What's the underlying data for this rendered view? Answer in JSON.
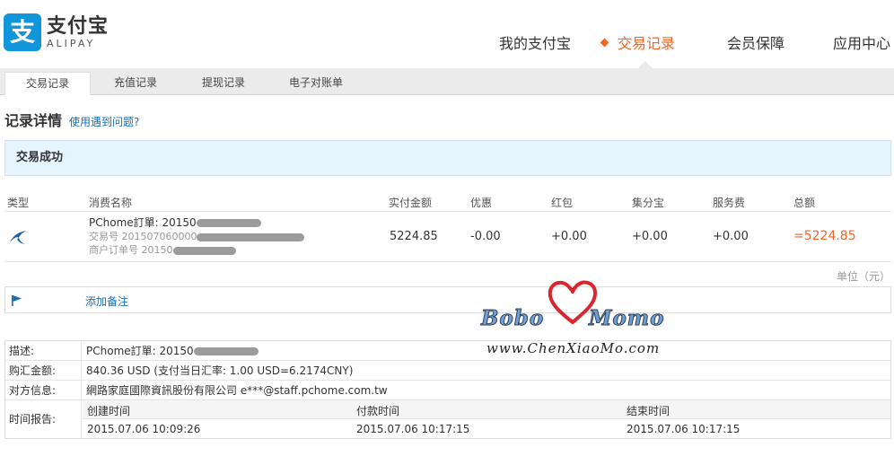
{
  "logo": {
    "mark": "支",
    "name_cn": "支付宝",
    "name_en": "ALIPAY"
  },
  "top_nav": {
    "items": [
      {
        "label": "我的支付宝"
      },
      {
        "label": "交易记录",
        "active": true
      },
      {
        "label": "会员保障"
      },
      {
        "label": "应用中心"
      }
    ],
    "active_color": "#f26522"
  },
  "sub_nav": {
    "items": [
      {
        "label": "交易记录",
        "active": true
      },
      {
        "label": "充值记录"
      },
      {
        "label": "提现记录"
      },
      {
        "label": "电子对账单"
      }
    ]
  },
  "page": {
    "title": "记录详情",
    "help_link": "使用遇到问题?"
  },
  "status": {
    "text": "交易成功"
  },
  "tx_table": {
    "headers": [
      "类型",
      "消费名称",
      "实付金额",
      "优惠",
      "红包",
      "集分宝",
      "服务费",
      "总额"
    ],
    "row": {
      "type_icon": "transfer-swallow-icon",
      "name": "PChome訂單: 20150",
      "trade_no": "交易号 201507060000",
      "merchant_order": "商户订单号 20150",
      "paid": "5224.85",
      "discount": "-0.00",
      "red_packet": "+0.00",
      "jifenbao": "+0.00",
      "service_fee": "+0.00",
      "total": "=5224.85"
    }
  },
  "unit_note": "单位（元）",
  "remark": {
    "icon": "flag-icon",
    "link": "添加备注"
  },
  "watermark": {
    "left": "Bobo",
    "right": "Momo",
    "url": "www.ChenXiaoMo.com",
    "heart_color": "#d9262c"
  },
  "details": {
    "description": {
      "label": "描述:",
      "value": "PChome訂單: 20150"
    },
    "fx_amount": {
      "label": "购汇金额:",
      "value": "840.36 USD (支付当日汇率: 1.00 USD=6.2174CNY)"
    },
    "counterparty": {
      "label": "对方信息:",
      "value": "網路家庭國際資訊股份有限公司 e***@staff.pchome.com.tw"
    },
    "time_report": {
      "label": "时间报告:",
      "headers": [
        "创建时间",
        "付款时间",
        "结束时间"
      ],
      "values": [
        "2015.07.06 10:09:26",
        "2015.07.06 10:17:15",
        "2015.07.06 10:17:15"
      ]
    }
  }
}
